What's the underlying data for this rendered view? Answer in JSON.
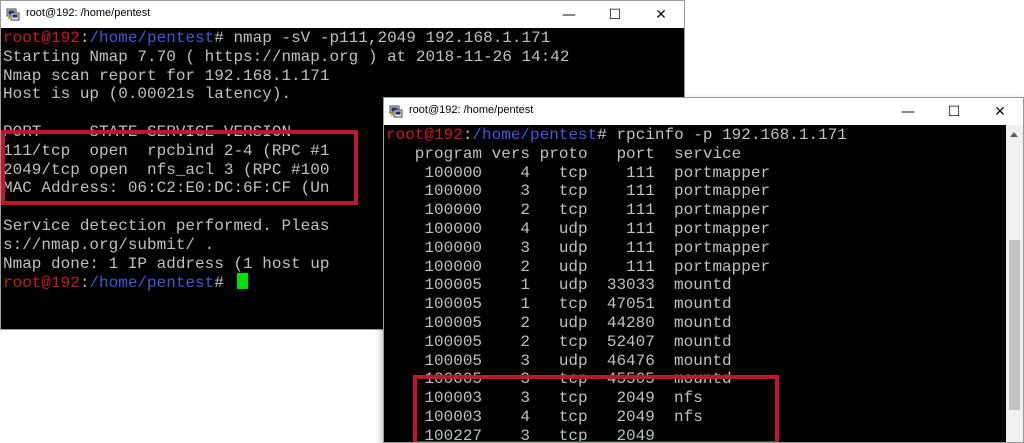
{
  "window1": {
    "title": "root@192: /home/pentest",
    "controls": {
      "minimize": "—",
      "maximize": "☐",
      "close": "✕"
    },
    "prompt": {
      "user": "root@192",
      "colon": ":",
      "path": "/home/pentest",
      "suffix": "# "
    },
    "command": "nmap -sV -p111,2049 192.168.1.171",
    "output": [
      "Starting Nmap 7.70 ( https://nmap.org ) at 2018-11-26 14:42",
      "Nmap scan report for 192.168.1.171",
      "Host is up (0.00021s latency).",
      "",
      "PORT     STATE SERVICE VERSION",
      "111/tcp  open  rpcbind 2-4 (RPC #1",
      "2049/tcp open  nfs_acl 3 (RPC #100",
      "MAC Address: 06:C2:E0:DC:6F:CF (Un",
      "",
      "Service detection performed. Pleas",
      "s://nmap.org/submit/ .",
      "Nmap done: 1 IP address (1 host up"
    ],
    "prompt_final": {
      "user": "root@192",
      "colon": ":",
      "path": "/home/pentest",
      "suffix": "# "
    }
  },
  "window2": {
    "title": "root@192: /home/pentest",
    "controls": {
      "minimize": "—",
      "maximize": "☐",
      "close": "✕"
    },
    "prompt": {
      "user": "root@192",
      "colon": ":",
      "path": "/home/pentest",
      "suffix": "# "
    },
    "command": "rpcinfo -p 192.168.1.171",
    "header": "   program vers proto   port  service",
    "rows": [
      "    100000    4   tcp    111  portmapper",
      "    100000    3   tcp    111  portmapper",
      "    100000    2   tcp    111  portmapper",
      "    100000    4   udp    111  portmapper",
      "    100000    3   udp    111  portmapper",
      "    100000    2   udp    111  portmapper",
      "    100005    1   udp  33033  mountd",
      "    100005    1   tcp  47051  mountd",
      "    100005    2   udp  44280  mountd",
      "    100005    2   tcp  52407  mountd",
      "    100005    3   udp  46476  mountd",
      "    100005    3   tcp  45505  mountd",
      "    100003    3   tcp   2049  nfs",
      "    100003    4   tcp   2049  nfs",
      "    100227    3   tcp   2049"
    ]
  },
  "colors": {
    "prompt_user": "#cc1a1a",
    "prompt_path": "#3b5bdb",
    "text": "#c0c0c0",
    "cursor": "#00e000",
    "highlight_box": "#c0182a"
  },
  "icons": {
    "terminal": "putty-terminal-icon"
  }
}
